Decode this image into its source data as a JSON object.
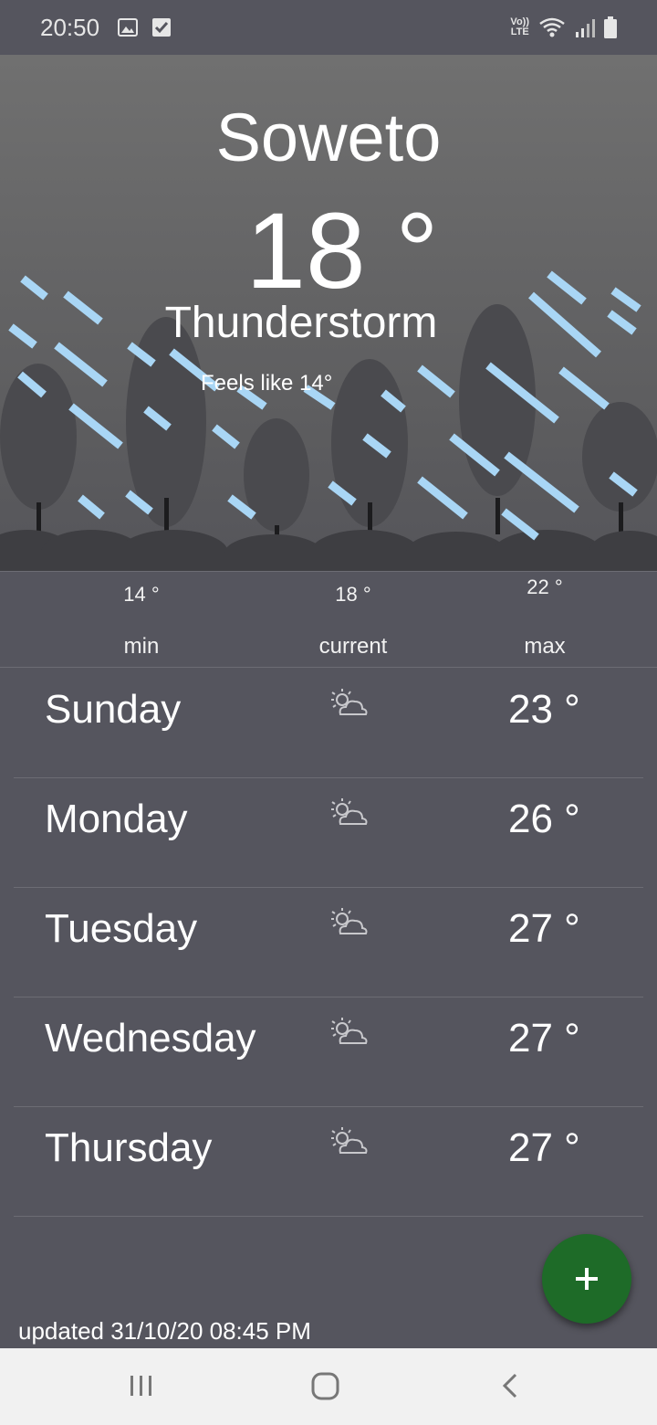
{
  "status_bar": {
    "time": "20:50",
    "lte_top": "Vo))",
    "lte_bottom": "LTE",
    "left_icons": [
      "image-icon",
      "checkbox-icon"
    ],
    "right_icons": [
      "wifi-icon",
      "signal-icon",
      "battery-icon"
    ]
  },
  "weather": {
    "city": "Soweto",
    "temperature": "18 °",
    "condition": "Thunderstorm",
    "feels_like": "Feels like 14°"
  },
  "summary": {
    "min_value": "14 °",
    "min_label": "min",
    "current_value": "18 °",
    "current_label": "current",
    "max_value": "22 °",
    "max_label": "max"
  },
  "forecast": [
    {
      "day": "Sunday",
      "icon": "partly-cloudy-icon",
      "temp": "23 °"
    },
    {
      "day": "Monday",
      "icon": "partly-cloudy-icon",
      "temp": "26 °"
    },
    {
      "day": "Tuesday",
      "icon": "partly-cloudy-icon",
      "temp": "27 °"
    },
    {
      "day": "Wednesday",
      "icon": "partly-cloudy-icon",
      "temp": "27 °"
    },
    {
      "day": "Thursday",
      "icon": "partly-cloudy-icon",
      "temp": "27 °"
    }
  ],
  "updated": "updated 31/10/20 08:45 PM",
  "fab_icon": "plus-icon",
  "colors": {
    "background": "#55555e",
    "fab": "#1e6b28",
    "rain": "#a9d6f5",
    "tree": "#4a4a4e"
  },
  "nav_bar": [
    "recent-apps-icon",
    "home-icon",
    "back-icon"
  ]
}
